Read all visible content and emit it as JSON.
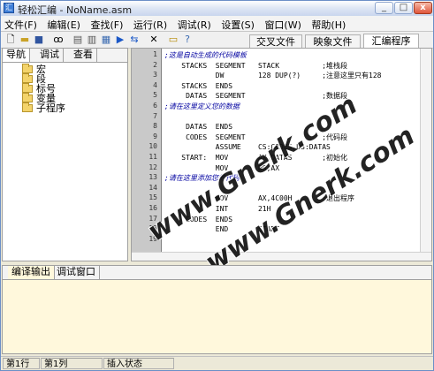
{
  "window": {
    "title": "轻松汇编 - NoName.asm",
    "minimize": "_",
    "maximize": "□",
    "close": "x"
  },
  "menu": [
    "文件(F)",
    "编辑(E)",
    "查找(F)",
    "运行(R)",
    "调试(R)",
    "设置(S)",
    "窗口(W)",
    "帮助(H)"
  ],
  "right_tabs": [
    "交叉文件",
    "映象文件",
    "汇编程序"
  ],
  "left_panel": {
    "tabs": [
      "导航",
      "调试",
      "查看"
    ],
    "tree": [
      "宏",
      "段",
      "标号",
      "变量",
      "子程序"
    ]
  },
  "editor": {
    "lines": [
      {
        "num": "1",
        "text": ";这是自动生成的代码模板",
        "comment": true
      },
      {
        "num": "2",
        "text": "    STACKS  SEGMENT   STACK          ;堆栈段",
        "comment": false
      },
      {
        "num": "3",
        "text": "            DW        128 DUP(?)     ;注意这里只有128",
        "comment": false
      },
      {
        "num": "4",
        "text": "    STACKS  ENDS",
        "comment": false
      },
      {
        "num": "5",
        "text": "     DATAS  SEGMENT                  ;数据段",
        "comment": false
      },
      {
        "num": "6",
        "text": ";请在这里定义您的数据",
        "comment": true
      },
      {
        "num": "7",
        "text": "",
        "comment": false
      },
      {
        "num": "8",
        "text": "     DATAS  ENDS",
        "comment": false
      },
      {
        "num": "9",
        "text": "     CODES  SEGMENT                  ;代码段",
        "comment": false
      },
      {
        "num": "10",
        "text": "            ASSUME    CS:CODES,DS:DATAS",
        "comment": false
      },
      {
        "num": "11",
        "text": "    START:  MOV       AX,DATAS       ;初始化",
        "comment": false
      },
      {
        "num": "12",
        "text": "            MOV       DS,AX",
        "comment": false
      },
      {
        "num": "13",
        "text": ";请在这里添加您的代码",
        "comment": true
      },
      {
        "num": "14",
        "text": "",
        "comment": false
      },
      {
        "num": "15",
        "text": "            MOV       AX,4C00H       ;退出程序",
        "comment": false
      },
      {
        "num": "16",
        "text": "            INT       21H",
        "comment": false
      },
      {
        "num": "17",
        "text": "     CODES  ENDS",
        "comment": false
      },
      {
        "num": "18",
        "text": "            END       START",
        "comment": false
      },
      {
        "num": "19",
        "text": "",
        "comment": false
      }
    ]
  },
  "watermarks": [
    "www.Gnerk.com",
    "www.Gnerk.com"
  ],
  "bottom_panel": {
    "tabs": [
      "编译输出",
      "调试窗口"
    ]
  },
  "status": {
    "row": "第1行",
    "col": "第1列",
    "mode": "插入状态"
  }
}
